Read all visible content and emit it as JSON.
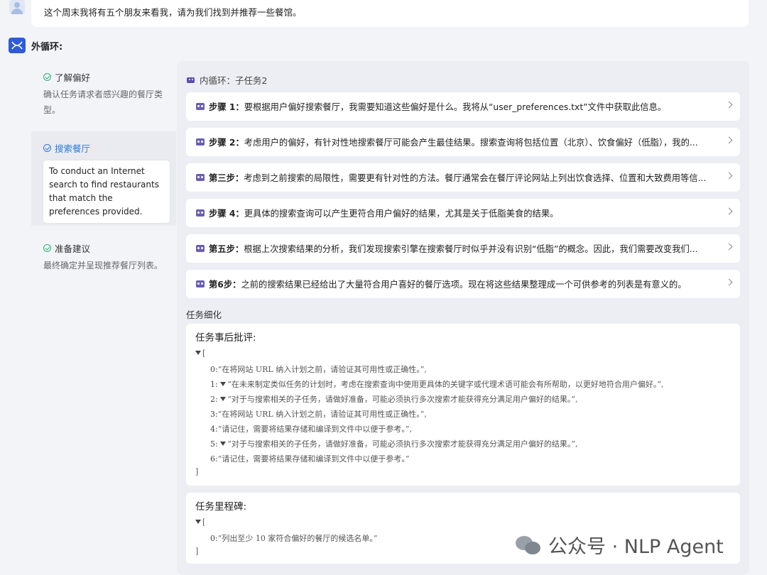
{
  "user_message": "这个周末我将有五个朋友来看我，请为我们找到并推荐一些餐馆。",
  "outer_loop": {
    "title": "外循环:",
    "items": [
      {
        "title": "了解偏好",
        "desc": "确认任务请求者感兴趣的餐厅类型。"
      },
      {
        "title": "搜索餐厅",
        "tooltip": "To conduct an Internet search to find restaurants that match the preferences provided."
      },
      {
        "title": "准备建议",
        "desc": "最终确定并呈现推荐餐厅列表。"
      }
    ]
  },
  "inner_loop": {
    "title": "内循环：子任务2",
    "steps": [
      {
        "label": "步骤 1：",
        "text": "要根据用户偏好搜索餐厅，我需要知道这些偏好是什么。我将从“user_preferences.txt”文件中获取此信息。"
      },
      {
        "label": "步骤 2：",
        "text": "考虑用户的偏好，有针对性地搜索餐厅可能会产生最佳结果。搜索查询将包括位置（北京）、饮食偏好（低脂），我的..."
      },
      {
        "label": "第三步：",
        "text": "考虑到之前搜索的局限性，需要更有针对性的方法。餐厅通常会在餐厅评论网站上列出饮食选择、位置和大致费用等信..."
      },
      {
        "label": "步骤 4：",
        "text": "更具体的搜索查询可以产生更符合用户偏好的结果，尤其是关于低脂美食的结果。"
      },
      {
        "label": "第五步：",
        "text": "根据上次搜索结果的分析，我们发现搜索引擎在搜索餐厅时似乎并没有识别“低脂”的概念。因此，我们需要改变我们..."
      },
      {
        "label": "第6步：",
        "text": "之前的搜索结果已经给出了大量符合用户喜好的餐厅选项。现在将这些结果整理成一个可供参考的列表是有意义的。"
      }
    ]
  },
  "task_refinement": {
    "title": "任务细化",
    "critique": {
      "title": "任务事后批评:",
      "open": "[",
      "close": "]",
      "entries": [
        {
          "idx": "0:",
          "text": "“在将网站 URL 纳入计划之前，请验证其可用性或正确性。”,"
        },
        {
          "idx": "1:",
          "text": "“在未来制定类似任务的计划时，考虑在搜索查询中使用更具体的关键字或代理术语可能会有所帮助，以更好地符合用户偏好。”,"
        },
        {
          "idx": "2:",
          "text": "“对于与搜索相关的子任务，请做好准备，可能必须执行多次搜索才能获得充分满足用户偏好的结果。”,"
        },
        {
          "idx": "3:",
          "text": "“在将网站 URL 纳入计划之前，请验证其可用性或正确性。”,"
        },
        {
          "idx": "4:",
          "text": "“请记住，需要将结果存储和编译到文件中以便于参考。”,"
        },
        {
          "idx": "5:",
          "text": "“对于与搜索相关的子任务，请做好准备，可能必须执行多次搜索才能获得充分满足用户偏好的结果。”,"
        },
        {
          "idx": "6:",
          "text": "“请记住，需要将结果存储和编译到文件中以便于参考。”"
        }
      ]
    },
    "milestones": {
      "title": "任务里程碑:",
      "open": "[",
      "close": "]",
      "entries": [
        {
          "idx": "0:",
          "text": "“列出至少 10 家符合偏好的餐厅的候选名单。”"
        }
      ]
    }
  },
  "watermark": "公众号 · NLP Agent"
}
